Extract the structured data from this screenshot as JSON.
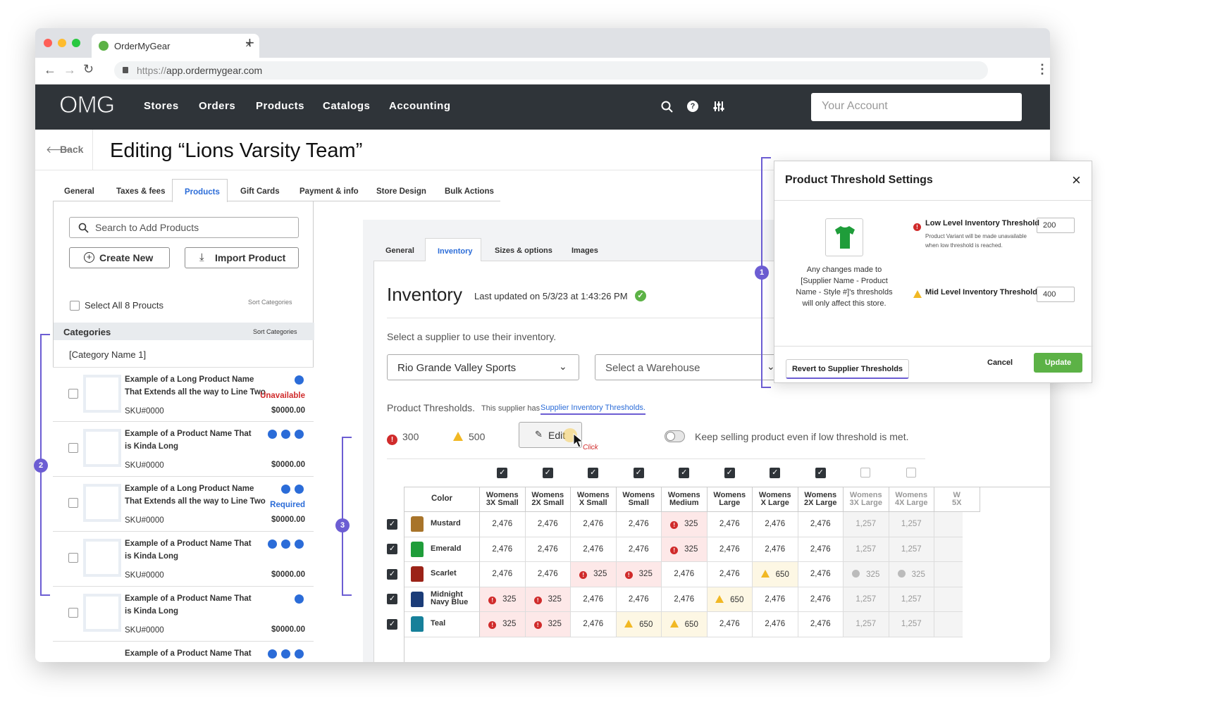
{
  "browser": {
    "tab_title": "OrderMyGear",
    "url_prefix": "https://",
    "url_domain": "app.ordermygear.com"
  },
  "nav": {
    "logo": "OMG",
    "links": [
      "Stores",
      "Orders",
      "Products",
      "Catalogs",
      "Accounting"
    ],
    "account_placeholder": "Your Account"
  },
  "page": {
    "back": "Back",
    "title": "Editing “Lions Varsity Team”"
  },
  "store_tabs": [
    "General",
    "Taxes & fees",
    "Products",
    "Gift Cards",
    "Payment & info",
    "Store Design",
    "Bulk Actions"
  ],
  "left": {
    "search_placeholder": "Search to Add Products",
    "create_new": "Create New",
    "import_product": "Import Product",
    "select_all": "Select All 8 Proucts",
    "sort_categories": "Sort Categories",
    "categories": "Categories",
    "category_name": "[Category Name 1]",
    "products": [
      {
        "name": "Example of a Long Product Name That Extends all the way to Line Two",
        "status": "Unavailable",
        "sku": "SKU#0000",
        "price": "$0000.00"
      },
      {
        "name": "Example of a Product Name That is Kinda Long",
        "status": "",
        "sku": "SKU#0000",
        "price": "$0000.00"
      },
      {
        "name": "Example of a Long Product Name That Extends all the way to Line Two",
        "status": "Required",
        "sku": "SKU#0000",
        "price": "$0000.00"
      },
      {
        "name": "Example of a Product Name That is Kinda Long",
        "status": "",
        "sku": "SKU#0000",
        "price": "$0000.00"
      },
      {
        "name": "Example of a Product Name That is Kinda Long",
        "status": "",
        "sku": "SKU#0000",
        "price": "$0000.00"
      },
      {
        "name": "Example of a Product Name That is",
        "status": "",
        "sku": "",
        "price": ""
      }
    ]
  },
  "product_tabs": [
    "General",
    "Inventory",
    "Sizes & options",
    "Images"
  ],
  "inventory": {
    "title": "Inventory",
    "last_updated": "Last updated on 5/3/23 at 1:43:26 PM",
    "supplier_prompt": "Select a supplier to use their inventory.",
    "supplier": "Rio Grande Valley Sports",
    "warehouse": "Select a Warehouse",
    "thresholds_label": "Product Thresholds.",
    "thresholds_note": "This supplier has",
    "thresholds_link": "Supplier Inventory Thresholds.",
    "low": "300",
    "mid": "500",
    "edit": "Edit",
    "click": "Click",
    "keep_selling": "Keep selling product even if low threshold is met.",
    "color_header": "Color",
    "sizes": [
      [
        "Womens",
        "3X Small"
      ],
      [
        "Womens",
        "2X Small"
      ],
      [
        "Womens",
        "X Small"
      ],
      [
        "Womens",
        "Small"
      ],
      [
        "Womens",
        "Medium"
      ],
      [
        "Womens",
        "Large"
      ],
      [
        "Womens",
        "X Large"
      ],
      [
        "Womens",
        "2X Large"
      ],
      [
        "Womens",
        "3X Large"
      ],
      [
        "Womens",
        "4X Large"
      ],
      [
        "W",
        "5X"
      ]
    ],
    "rows": [
      {
        "color": "Mustard",
        "shirt": "#a8742a",
        "cells": [
          [
            "2,476",
            "n"
          ],
          [
            "2,476",
            "n"
          ],
          [
            "2,476",
            "n"
          ],
          [
            "2,476",
            "n"
          ],
          [
            "325",
            "r"
          ],
          [
            "2,476",
            "n"
          ],
          [
            "2,476",
            "n"
          ],
          [
            "2,476",
            "n"
          ],
          [
            "1,257",
            "g"
          ],
          [
            "1,257",
            "g"
          ]
        ]
      },
      {
        "color": "Emerald",
        "shirt": "#1f9d3a",
        "cells": [
          [
            "2,476",
            "n"
          ],
          [
            "2,476",
            "n"
          ],
          [
            "2,476",
            "n"
          ],
          [
            "2,476",
            "n"
          ],
          [
            "325",
            "r"
          ],
          [
            "2,476",
            "n"
          ],
          [
            "2,476",
            "n"
          ],
          [
            "2,476",
            "n"
          ],
          [
            "1,257",
            "g"
          ],
          [
            "1,257",
            "g"
          ]
        ]
      },
      {
        "color": "Scarlet",
        "shirt": "#9b2318",
        "cells": [
          [
            "2,476",
            "n"
          ],
          [
            "2,476",
            "n"
          ],
          [
            "325",
            "r"
          ],
          [
            "325",
            "r"
          ],
          [
            "2,476",
            "n"
          ],
          [
            "2,476",
            "n"
          ],
          [
            "650",
            "y"
          ],
          [
            "2,476",
            "n"
          ],
          [
            "325",
            "gi"
          ],
          [
            "325",
            "gi"
          ]
        ]
      },
      {
        "color": "Midnight Navy Blue",
        "shirt": "#1b3c78",
        "cells": [
          [
            "325",
            "r"
          ],
          [
            "325",
            "r"
          ],
          [
            "2,476",
            "n"
          ],
          [
            "2,476",
            "n"
          ],
          [
            "2,476",
            "n"
          ],
          [
            "650",
            "y"
          ],
          [
            "2,476",
            "n"
          ],
          [
            "2,476",
            "n"
          ],
          [
            "1,257",
            "g"
          ],
          [
            "1,257",
            "g"
          ]
        ]
      },
      {
        "color": "Teal",
        "shirt": "#16809a",
        "cells": [
          [
            "325",
            "r"
          ],
          [
            "325",
            "r"
          ],
          [
            "2,476",
            "n"
          ],
          [
            "650",
            "y"
          ],
          [
            "650",
            "y"
          ],
          [
            "2,476",
            "n"
          ],
          [
            "2,476",
            "n"
          ],
          [
            "2,476",
            "n"
          ],
          [
            "1,257",
            "g"
          ],
          [
            "1,257",
            "g"
          ]
        ]
      }
    ],
    "col_checked": [
      true,
      true,
      true,
      true,
      true,
      true,
      true,
      true,
      false,
      false
    ]
  },
  "modal": {
    "title": "Product Threshold Settings",
    "note": "Any changes made to [Supplier Name - Product Name - Style #]'s thresholds will only affect this store.",
    "low_label": "Low Level Inventory Threshold",
    "low_value": "200",
    "low_help": "Product Variant will be made unavailable when low threshold is reached.",
    "mid_label": "Mid Level Inventory Threshold",
    "mid_value": "400",
    "revert": "Revert to Supplier Thresholds",
    "cancel": "Cancel",
    "update": "Update",
    "accent": "#5cb246"
  },
  "callouts": [
    "1",
    "2",
    "3"
  ]
}
